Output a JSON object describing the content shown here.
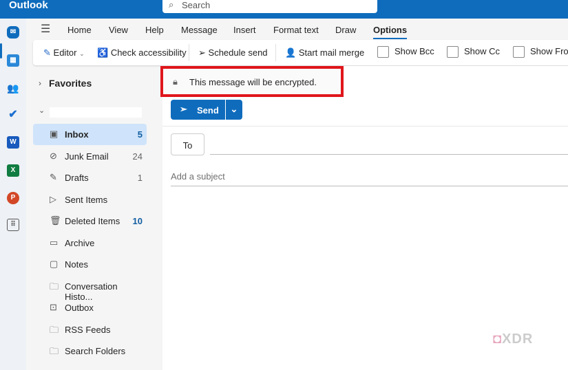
{
  "app": {
    "title": "Outlook",
    "search_placeholder": "Search"
  },
  "tabs": [
    "Home",
    "View",
    "Help",
    "Message",
    "Insert",
    "Format text",
    "Draw",
    "Options"
  ],
  "active_tab": "Options",
  "toolbar": {
    "editor": "Editor",
    "check_accessibility": "Check accessibility",
    "schedule_send": "Schedule send",
    "start_mail_merge": "Start mail merge",
    "show_bcc": "Show Bcc",
    "show_cc": "Show Cc",
    "show_from": "Show From"
  },
  "favorites": "Favorites",
  "folders": [
    {
      "label": "Inbox",
      "count": "5"
    },
    {
      "label": "Junk Email",
      "count": "24"
    },
    {
      "label": "Drafts",
      "count": "1"
    },
    {
      "label": "Sent Items",
      "count": ""
    },
    {
      "label": "Deleted Items",
      "count": "10"
    },
    {
      "label": "Archive",
      "count": ""
    },
    {
      "label": "Notes",
      "count": ""
    },
    {
      "label": "Conversation Histo...",
      "count": ""
    },
    {
      "label": "Outbox",
      "count": ""
    },
    {
      "label": "RSS Feeds",
      "count": ""
    },
    {
      "label": "Search Folders",
      "count": ""
    }
  ],
  "compose": {
    "banner": "This message will be encrypted.",
    "send": "Send",
    "to": "To",
    "subject_placeholder": "Add a subject"
  },
  "watermark": "XDA",
  "colors": {
    "brand": "#0f6cbd",
    "highlight": "#e0161c"
  }
}
